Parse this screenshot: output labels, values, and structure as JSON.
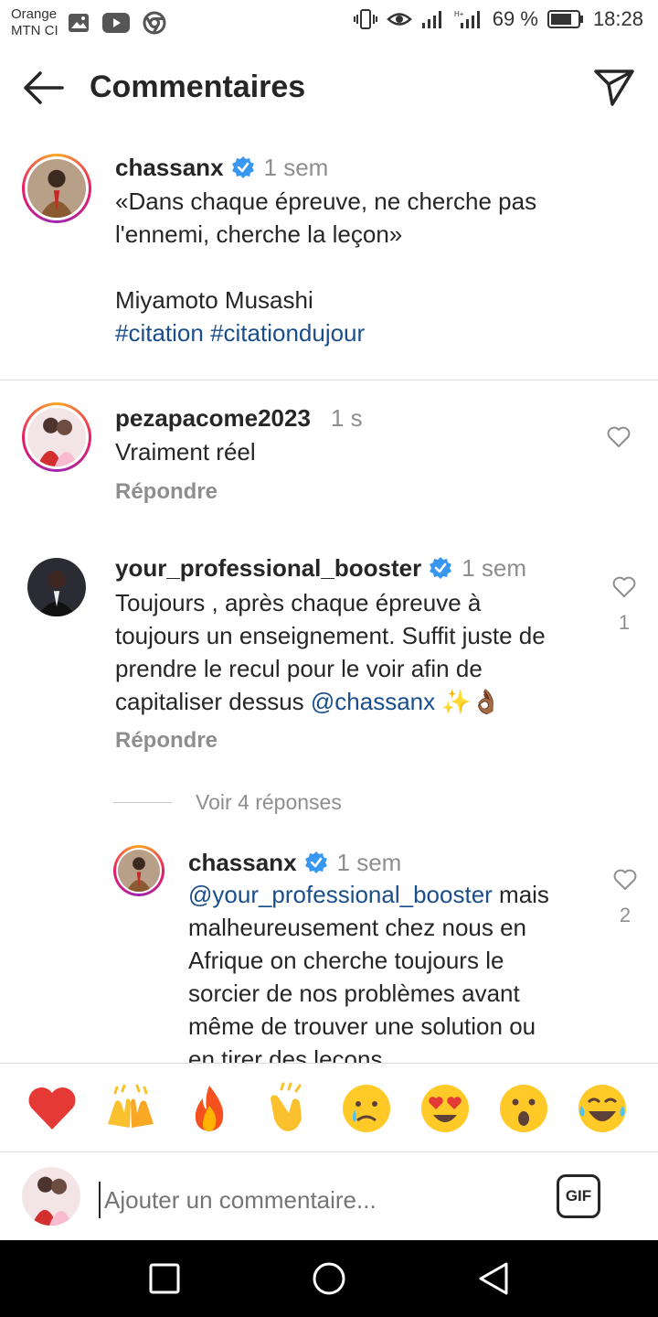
{
  "status_bar": {
    "carrier_line1": "Orange",
    "carrier_line2": "MTN CI",
    "battery": "69 %",
    "time": "18:28"
  },
  "header": {
    "title": "Commentaires"
  },
  "post": {
    "username": "chassanx",
    "time": "1 sem",
    "text_line1": "«Dans chaque épreuve, ne cherche pas",
    "text_line2": "l'ennemi, cherche la leçon»",
    "author": "Miyamoto Musashi",
    "hashtags": "#citation #citationdujour"
  },
  "comments": [
    {
      "username": "pezapacome2023",
      "time": "1 s",
      "text": "Vraiment réel",
      "reply_label": "Répondre",
      "likes": ""
    },
    {
      "username": "your_professional_booster",
      "time": "1 sem",
      "text_line1": "Toujours , après chaque épreuve à",
      "text_line2": "toujours un enseignement. Suffit juste de",
      "text_line3": "prendre le recul pour le voir afin de",
      "text_line4_prefix": "capitaliser dessus ",
      "mention": "@chassanx",
      "emojis": "✨👌🏾",
      "reply_label": "Répondre",
      "likes": "1"
    }
  ],
  "view_replies": "Voir 4 réponses",
  "reply": {
    "username": "chassanx",
    "time": "1 sem",
    "mention": "@your_professional_booster",
    "text_line1_suffix": " mais",
    "text_line2": "malheureusement chez nous en",
    "text_line3": "Afrique on cherche toujours le",
    "text_line4": "sorcier de nos problèmes avant",
    "text_line5": "même de trouver une solution ou",
    "text_line6": "en tirer des leçons",
    "likes": "2"
  },
  "emoji_bar": [
    "❤️",
    "🙌",
    "🔥",
    "👏",
    "😢",
    "😍",
    "😮",
    "😂"
  ],
  "input": {
    "placeholder": "Ajouter un commentaire...",
    "gif_label": "GIF"
  }
}
